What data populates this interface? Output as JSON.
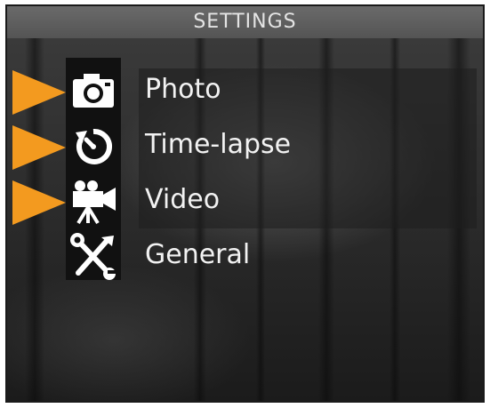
{
  "header": {
    "title": "SETTINGS"
  },
  "menu": {
    "items": [
      {
        "label": "Photo",
        "icon": "camera-icon",
        "has_arrow": true
      },
      {
        "label": "Time-lapse",
        "icon": "timer-icon",
        "has_arrow": true
      },
      {
        "label": "Video",
        "icon": "video-camera-icon",
        "has_arrow": true
      },
      {
        "label": "General",
        "icon": "tools-icon",
        "has_arrow": false
      }
    ]
  },
  "colors": {
    "accent": "#f39a1f",
    "header_bg": "#5e5e5e",
    "text": "#f2f2f2"
  }
}
